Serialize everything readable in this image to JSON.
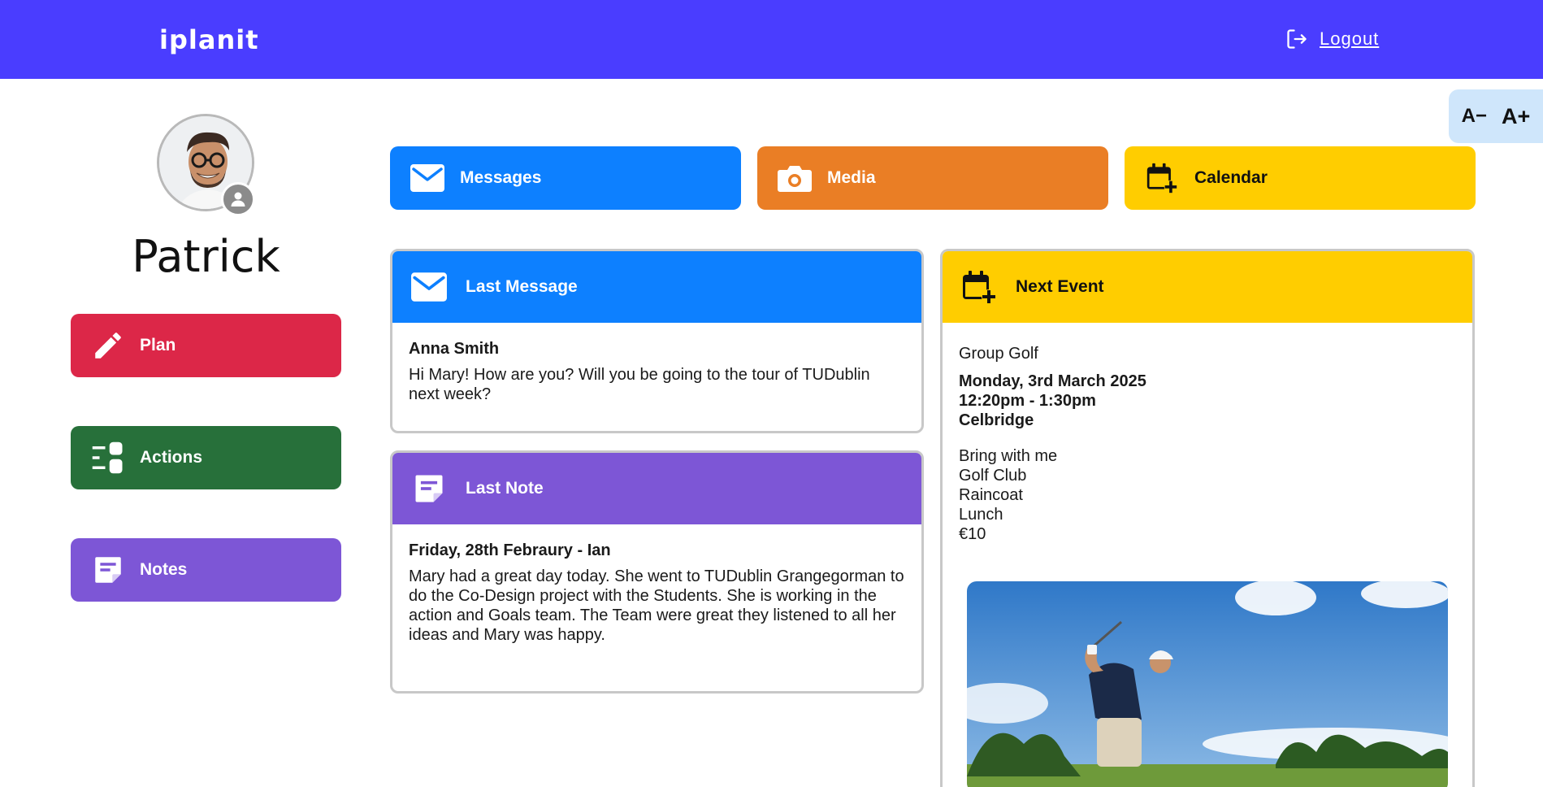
{
  "app": {
    "brand": "iplanit",
    "logout_label": "Logout"
  },
  "font_controls": {
    "decrease": "A−",
    "increase": "A+"
  },
  "user": {
    "name": "Patrick"
  },
  "sidebar": {
    "items": [
      {
        "label": "Plan",
        "icon": "pencil-icon",
        "color": "#dc2748"
      },
      {
        "label": "Actions",
        "icon": "toggles-icon",
        "color": "#27703a"
      },
      {
        "label": "Notes",
        "icon": "note-icon",
        "color": "#7d56d6"
      }
    ]
  },
  "tiles": [
    {
      "label": "Messages",
      "icon": "envelope-icon",
      "color": "#0d80ff"
    },
    {
      "label": "Media",
      "icon": "camera-icon",
      "color": "#ea7e25"
    },
    {
      "label": "Calendar",
      "icon": "calendar-plus-icon",
      "color": "#ffcd00"
    }
  ],
  "last_message": {
    "heading": "Last Message",
    "sender": "Anna Smith",
    "text": "Hi Mary! How are you? Will you be going to the tour of TUDublin next week?"
  },
  "last_note": {
    "heading": "Last Note",
    "title": "Friday, 28th Febraury - Ian",
    "text": "Mary had a great day today. She went to TUDublin Grangegorman to do the Co-Design project with the Students. She is working in the action and Goals team. The Team were great they listened to all her ideas and Mary was happy."
  },
  "next_event": {
    "heading": "Next Event",
    "title": "Group Golf",
    "date": "Monday, 3rd March 2025",
    "time": "12:20pm - 1:30pm",
    "location": "Celbridge",
    "bring_label": "Bring with me",
    "items": [
      "Golf Club",
      "Raincoat",
      "Lunch",
      "€10"
    ]
  },
  "colors": {
    "header": "#4a3dff",
    "font_panel": "#cfe6fb"
  }
}
